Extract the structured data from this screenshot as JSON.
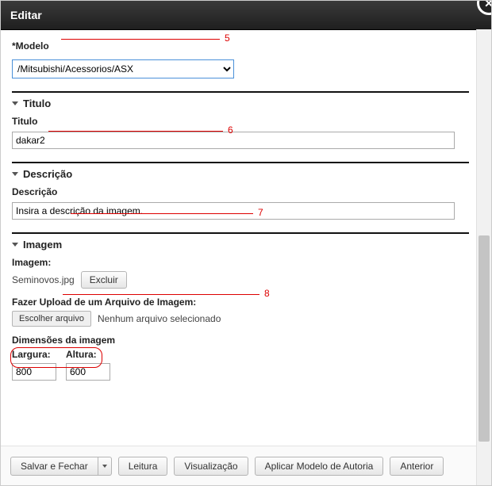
{
  "window": {
    "title": "Editar"
  },
  "modelo": {
    "label": "*Modelo",
    "selected": "/Mitsubishi/Acessorios/ASX",
    "annotation": "5"
  },
  "titulo_section": {
    "heading": "Titulo",
    "field_label": "Titulo",
    "value": "dakar2",
    "annotation": "6"
  },
  "descricao_section": {
    "heading": "Descrição",
    "field_label": "Descrição",
    "value": "Insira a descrição da imagem.",
    "annotation": "7"
  },
  "imagem_section": {
    "heading": "Imagem",
    "field_label": "Imagem:",
    "filename": "Seminovos.jpg",
    "delete_label": "Excluir",
    "upload_label": "Fazer Upload de um Arquivo de Imagem:",
    "choose_label": "Escolher arquivo",
    "no_file_text": "Nenhum arquivo selecionado",
    "dims_label": "Dimensões da imagem",
    "width_label": "Largura:",
    "height_label": "Altura:",
    "width_value": "800",
    "height_value": "600",
    "annotation": "8"
  },
  "footer": {
    "save_close": "Salvar e Fechar",
    "read": "Leitura",
    "preview": "Visualização",
    "apply_template": "Aplicar Modelo de Autoria",
    "prev": "Anterior"
  }
}
